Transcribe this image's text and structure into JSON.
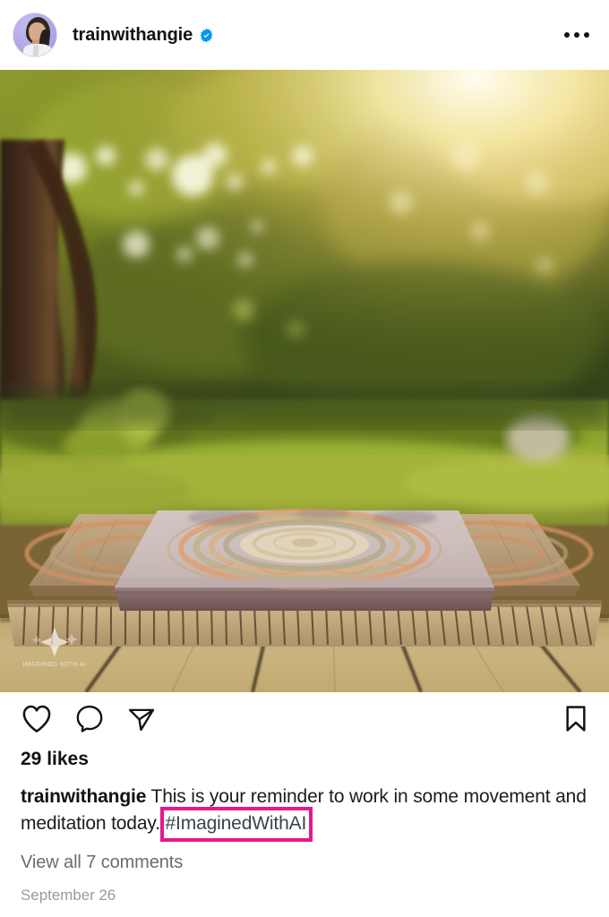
{
  "post": {
    "header": {
      "username": "trainwithangie",
      "verified": true,
      "verified_icon": "verified-badge-icon",
      "avatar_icon": "user-avatar",
      "avatar_bg_color": "#b0a6e6",
      "more_options_icon": "more-options-icon",
      "more_options_label": "•••"
    },
    "photo": {
      "alt": "Meditation cushion with mandala pattern on a woven mat atop a wooden deck in a sunlit garden",
      "watermark_icon": "ai-sparkle-watermark-icon",
      "watermark_label": "IMAGINED WITH AI"
    },
    "actions": {
      "like_icon": "heart-icon",
      "comment_icon": "comment-icon",
      "share_icon": "share-paper-plane-icon",
      "save_icon": "bookmark-icon"
    },
    "engagement": {
      "likes_text": "29 likes",
      "likes_count": 29
    },
    "caption": {
      "author": "trainwithangie",
      "text_before": " This is your reminder to work in some movement and meditation today. ",
      "hashtag": "#ImaginedWithAI",
      "hashtag_color": "#38454f",
      "annotation_color": "#e8188c"
    },
    "comments": {
      "view_all_label": "View all 7 comments",
      "count": 7
    },
    "timestamp": "September 26"
  },
  "chart_data": null
}
